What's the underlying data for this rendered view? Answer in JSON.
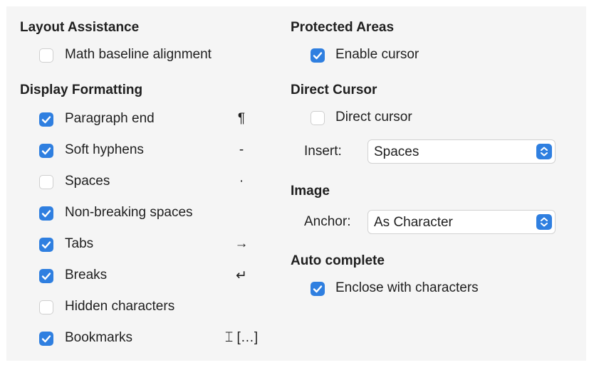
{
  "layout_assistance": {
    "heading": "Layout Assistance",
    "math_baseline_alignment": {
      "label": "Math baseline alignment",
      "checked": false
    }
  },
  "display_formatting": {
    "heading": "Display Formatting",
    "items": [
      {
        "label": "Paragraph end",
        "checked": true,
        "symbol": "¶"
      },
      {
        "label": "Soft hyphens",
        "checked": true,
        "symbol": "-"
      },
      {
        "label": "Spaces",
        "checked": false,
        "symbol": "·"
      },
      {
        "label": "Non-breaking spaces",
        "checked": true,
        "symbol": ""
      },
      {
        "label": "Tabs",
        "checked": true,
        "symbol": "→"
      },
      {
        "label": "Breaks",
        "checked": true,
        "symbol": "↵"
      },
      {
        "label": "Hidden characters",
        "checked": false,
        "symbol": ""
      },
      {
        "label": "Bookmarks",
        "checked": true,
        "symbol": "⌶ […]"
      }
    ]
  },
  "protected_areas": {
    "heading": "Protected Areas",
    "enable_cursor": {
      "label": "Enable cursor",
      "checked": true
    }
  },
  "direct_cursor": {
    "heading": "Direct Cursor",
    "direct_cursor": {
      "label": "Direct cursor",
      "checked": false
    },
    "insert": {
      "label": "Insert:",
      "value": "Spaces"
    }
  },
  "image": {
    "heading": "Image",
    "anchor": {
      "label": "Anchor:",
      "value": "As Character"
    }
  },
  "auto_complete": {
    "heading": "Auto complete",
    "enclose": {
      "label": "Enclose with characters",
      "checked": true
    }
  },
  "colors": {
    "accent": "#2f7fe0",
    "panel_bg": "#f5f5f5"
  },
  "icons": {
    "checkbox_checked": "checkmark-icon",
    "select_stepper": "up-down-chevron-icon"
  }
}
